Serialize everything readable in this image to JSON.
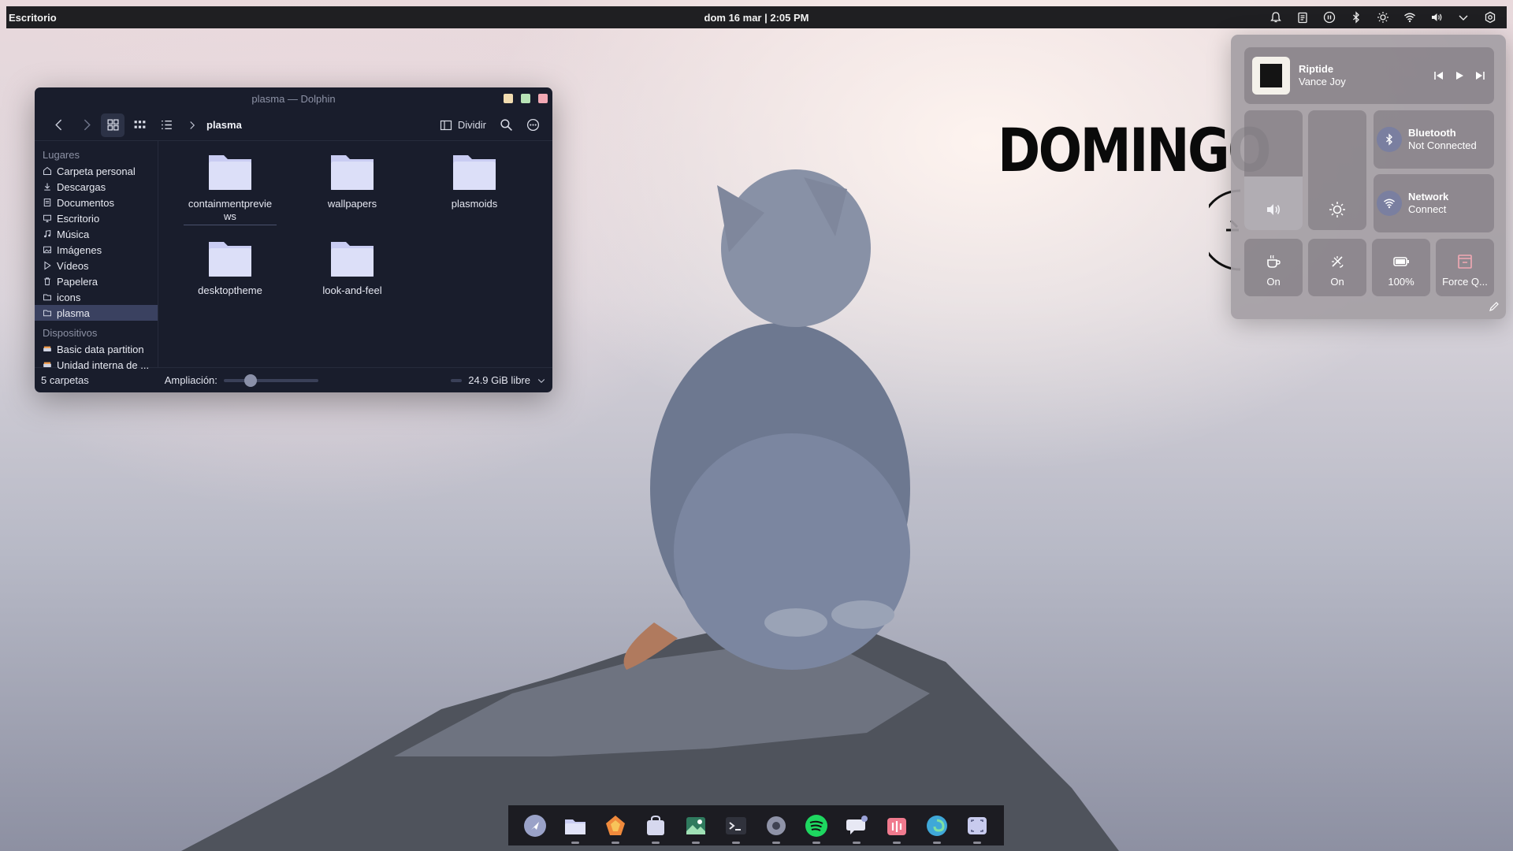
{
  "topbar": {
    "left_label": "Escritorio",
    "clock": "dom 16 mar | 2:05 PM",
    "tray_icons": [
      "notification-bell-icon",
      "clipboard-icon",
      "media-pause-icon",
      "bluetooth-icon",
      "brightness-icon",
      "wifi-icon",
      "volume-icon",
      "chevron-down-icon",
      "settings-icon"
    ]
  },
  "dolphin": {
    "title": "plasma — Dolphin",
    "breadcrumb": "plasma",
    "split_label": "Dividir",
    "sidebar": {
      "places_header": "Lugares",
      "places": [
        {
          "label": "Carpeta personal",
          "icon": "home-icon"
        },
        {
          "label": "Descargas",
          "icon": "download-icon"
        },
        {
          "label": "Documentos",
          "icon": "document-icon"
        },
        {
          "label": "Escritorio",
          "icon": "desktop-icon"
        },
        {
          "label": "Música",
          "icon": "music-icon"
        },
        {
          "label": "Imágenes",
          "icon": "image-icon"
        },
        {
          "label": "Vídeos",
          "icon": "video-icon"
        },
        {
          "label": "Papelera",
          "icon": "trash-icon"
        },
        {
          "label": "icons",
          "icon": "folder-icon"
        },
        {
          "label": "plasma",
          "icon": "folder-icon"
        }
      ],
      "devices_header": "Dispositivos",
      "devices": [
        {
          "label": "Basic data partition",
          "icon": "drive-icon"
        },
        {
          "label": "Unidad interna de ...",
          "icon": "drive-icon"
        }
      ]
    },
    "folders": [
      "containmentpreviews",
      "wallpapers",
      "plasmoids",
      "desktoptheme",
      "look-and-feel"
    ],
    "folder_label_0": "containmentprevie\nws",
    "status": {
      "count": "5 carpetas",
      "zoom_label": "Ampliación:",
      "zoom_level": 0.25,
      "free_space": "24.9 GiB libre"
    },
    "colors": {
      "window_bg": "#191d2c",
      "minimize": "#f1dcb0",
      "maximize": "#b8e3b6",
      "close": "#f1a8b4",
      "folder": "#c9ccf2"
    }
  },
  "desktop": {
    "weekday_text": "DOMINGO"
  },
  "control_center": {
    "media": {
      "title": "Riptide",
      "artist": "Vance Joy"
    },
    "volume_level": 0.45,
    "brightness_level": 0.0,
    "bluetooth": {
      "title": "Bluetooth",
      "status": "Not Connected"
    },
    "network": {
      "title": "Network",
      "status": "Connect"
    },
    "toggles": [
      {
        "icon": "coffee-cup-icon",
        "label": "On"
      },
      {
        "icon": "night-light-off-icon",
        "label": "On"
      },
      {
        "icon": "battery-icon",
        "label": "100%"
      },
      {
        "icon": "force-quit-icon",
        "label": "Force Q..."
      }
    ]
  },
  "dock": {
    "apps": [
      {
        "name": "launcher-icon",
        "running": false
      },
      {
        "name": "file-manager-icon",
        "running": true
      },
      {
        "name": "firefox-icon",
        "running": true
      },
      {
        "name": "software-store-icon",
        "running": true
      },
      {
        "name": "image-viewer-icon",
        "running": true
      },
      {
        "name": "terminal-icon",
        "running": true
      },
      {
        "name": "system-settings-icon",
        "running": true
      },
      {
        "name": "spotify-icon",
        "running": true
      },
      {
        "name": "chat-icon",
        "running": true
      },
      {
        "name": "audio-app-icon",
        "running": true
      },
      {
        "name": "edge-browser-icon",
        "running": true
      },
      {
        "name": "screenshot-icon",
        "running": true
      }
    ]
  }
}
